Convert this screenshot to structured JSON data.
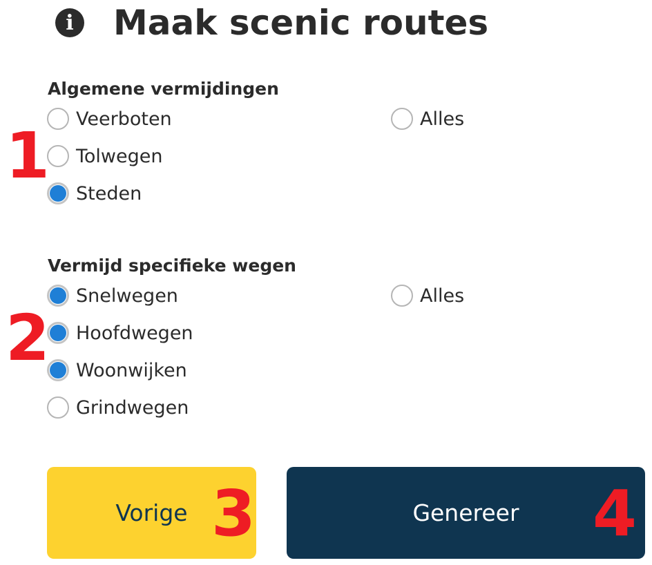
{
  "header": {
    "title": "Maak scenic routes",
    "icon": "info-icon"
  },
  "general_avoidances": {
    "heading": "Algemene vermijdingen",
    "options": [
      {
        "label": "Veerboten",
        "checked": false
      },
      {
        "label": "Tolwegen",
        "checked": false
      },
      {
        "label": "Steden",
        "checked": true
      }
    ],
    "all": {
      "label": "Alles",
      "checked": false
    }
  },
  "specific_roads": {
    "heading": "Vermijd specifieke wegen",
    "options": [
      {
        "label": "Snelwegen",
        "checked": true
      },
      {
        "label": "Hoofdwegen",
        "checked": true
      },
      {
        "label": "Woonwijken",
        "checked": true
      },
      {
        "label": "Grindwegen",
        "checked": false
      }
    ],
    "all": {
      "label": "Alles",
      "checked": false
    }
  },
  "buttons": {
    "previous": "Vorige",
    "generate": "Genereer"
  },
  "annotations": [
    "1",
    "2",
    "3",
    "4"
  ],
  "colors": {
    "radio_checked": "#1f7fd6",
    "previous_button": "#fdd22f",
    "generate_button": "#0f3550",
    "annotation": "#ee1c24"
  }
}
